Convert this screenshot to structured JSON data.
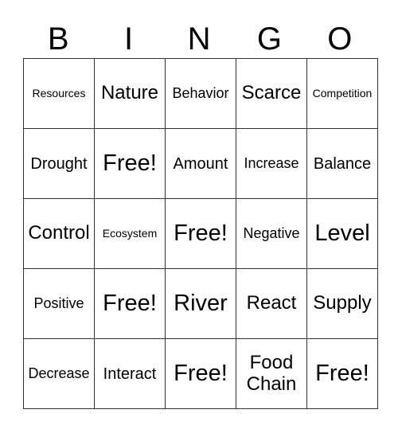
{
  "header": [
    "B",
    "I",
    "N",
    "G",
    "O"
  ],
  "rows": [
    [
      "Resources",
      "Nature",
      "Behavior",
      "Scarce",
      "Competition"
    ],
    [
      "Drought",
      "Free!",
      "Amount",
      "Increase",
      "Balance"
    ],
    [
      "Control",
      "Ecosystem",
      "Free!",
      "Negative",
      "Level"
    ],
    [
      "Positive",
      "Free!",
      "River",
      "React",
      "Supply"
    ],
    [
      "Decrease",
      "Interact",
      "Free!",
      "Food Chain",
      "Free!"
    ]
  ]
}
